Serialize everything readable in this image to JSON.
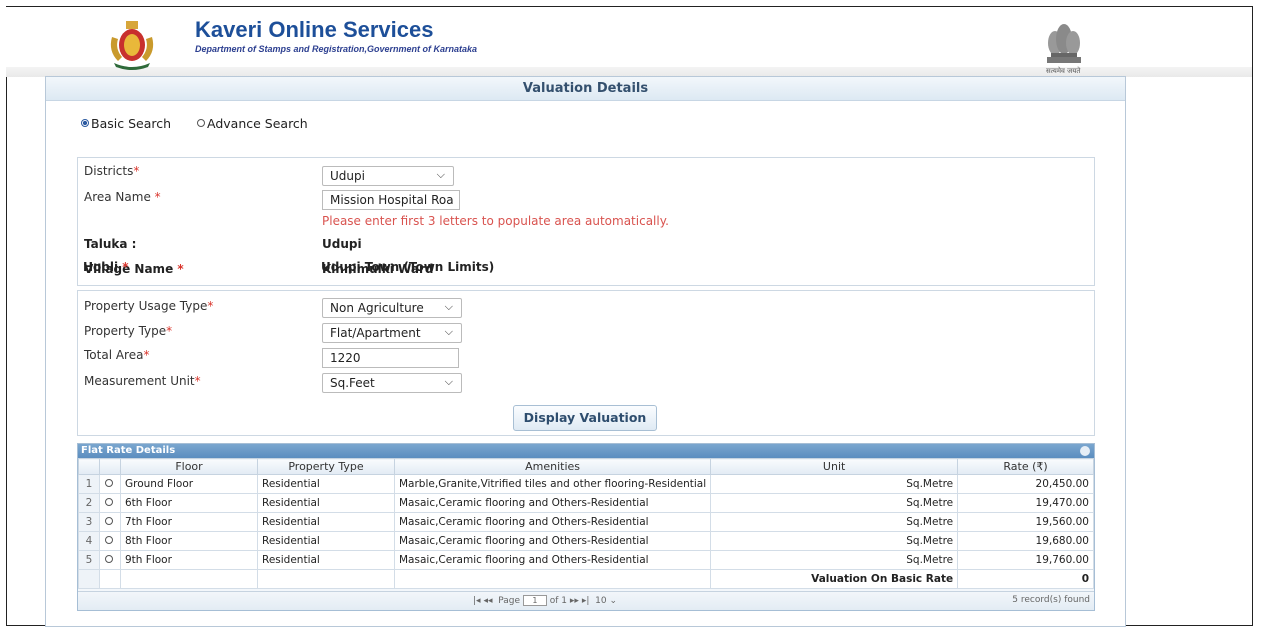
{
  "header": {
    "title": "Kaveri Online Services",
    "subtitle": "Department of Stamps and Registration,Government of Karnataka",
    "motto": "सत्यमेव जयते"
  },
  "panel": {
    "title": "Valuation Details"
  },
  "search_mode": {
    "options": [
      "Basic Search",
      "Advance Search"
    ],
    "selected": "Basic Search"
  },
  "location": {
    "district_label": "Districts",
    "district_value": "Udupi",
    "area_label": "Area Name ",
    "area_value": "Mission Hospital Roa",
    "area_hint": "Please enter first 3 letters to populate area automatically.",
    "taluka_label": "Taluka :",
    "taluka_value": "Udupi",
    "village_label": "Village Name ",
    "village_value": "Kinnimulki Ward",
    "hobli_label": "Hobli ",
    "hobli_value": "Udupi Town (Town Limits)",
    "req": "*"
  },
  "property": {
    "usage_label": "Property Usage Type",
    "usage_value": "Non Agriculture",
    "type_label": "Property Type",
    "type_value": "Flat/Apartment",
    "area_label": "Total Area",
    "area_value": "1220",
    "unit_label": "Measurement Unit",
    "unit_value": "Sq.Feet",
    "button": "Display Valuation"
  },
  "grid": {
    "caption": "Flat Rate Details",
    "columns": [
      "Floor",
      "Property Type",
      "Amenities",
      "Unit",
      "Rate  (₹)"
    ],
    "rows": [
      {
        "n": "1",
        "floor": "Ground Floor",
        "ptype": "Residential",
        "amenities": "Marble,Granite,Vitrified tiles and other flooring-Residential",
        "unit": "Sq.Metre",
        "rate": "20,450.00"
      },
      {
        "n": "2",
        "floor": "6th Floor",
        "ptype": "Residential",
        "amenities": "Masaic,Ceramic flooring and Others-Residential",
        "unit": "Sq.Metre",
        "rate": "19,470.00"
      },
      {
        "n": "3",
        "floor": "7th Floor",
        "ptype": "Residential",
        "amenities": "Masaic,Ceramic flooring and Others-Residential",
        "unit": "Sq.Metre",
        "rate": "19,560.00"
      },
      {
        "n": "4",
        "floor": "8th Floor",
        "ptype": "Residential",
        "amenities": "Masaic,Ceramic flooring and Others-Residential",
        "unit": "Sq.Metre",
        "rate": "19,680.00"
      },
      {
        "n": "5",
        "floor": "9th Floor",
        "ptype": "Residential",
        "amenities": "Masaic,Ceramic flooring and Others-Residential",
        "unit": "Sq.Metre",
        "rate": "19,760.00"
      }
    ],
    "footer_label": "Valuation On Basic Rate",
    "footer_value": "0",
    "pager": {
      "page_label": "Page",
      "page_value": "1",
      "of_label": "of 1",
      "page_size": "10",
      "record_count": "5 record(s) found"
    }
  }
}
